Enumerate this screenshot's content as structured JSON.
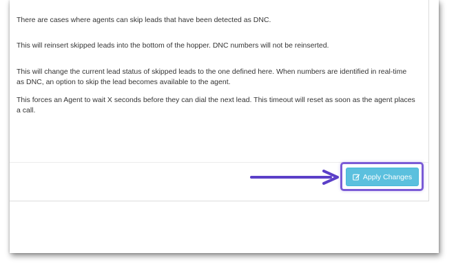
{
  "descriptions": [
    "There are cases where agents can skip leads that have been detected as DNC.",
    "This will reinsert skipped leads into the bottom of the hopper. DNC numbers will not be reinserted.",
    "This will change the current lead status of skipped leads to the one defined here. When numbers are identified in real-time as DNC, an option to skip the lead becomes available to the agent.",
    "This forces an Agent to wait X seconds before they can dial the next lead. This timeout will reset as soon as the agent places a call."
  ],
  "footer": {
    "apply_label": "Apply Changes",
    "apply_icon": "edit-icon"
  },
  "colors": {
    "button": "#5bc0de",
    "annotation": "#5b3fc8"
  }
}
